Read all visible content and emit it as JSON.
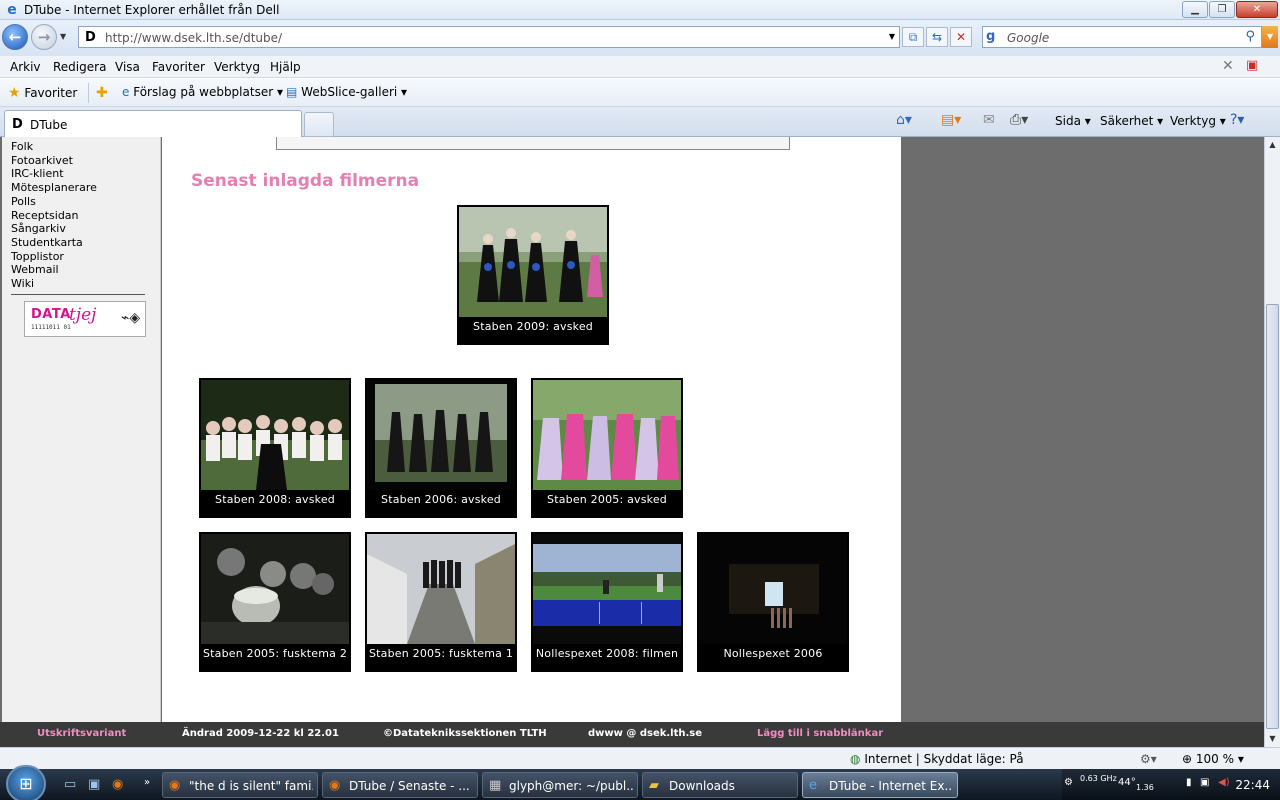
{
  "window": {
    "title": "DTube - Internet Explorer erhållet från Dell",
    "buttons": {
      "minimize": "▁",
      "maximize": "❐",
      "close": "✕"
    }
  },
  "address": {
    "url": "http://www.dsek.lth.se/dtube/",
    "search_placeholder": "Google"
  },
  "menu": [
    "Arkiv",
    "Redigera",
    "Visa",
    "Favoriter",
    "Verktyg",
    "Hjälp"
  ],
  "favorites_bar": {
    "favorites": "Favoriter",
    "suggested": "Förslag på webbplatser ▾",
    "webslice": "WebSlice-galleri ▾"
  },
  "tab": {
    "label": "DTube"
  },
  "commands": {
    "page": "Sida ▾",
    "safety": "Säkerhet ▾",
    "tools": "Verktyg ▾"
  },
  "sidebar": {
    "links": [
      "Folk",
      "Fotoarkivet",
      "IRC-klient",
      "Mötesplanerare",
      "Polls",
      "Receptsidan",
      "Sångarkiv",
      "Studentkarta",
      "Topplistor",
      "Webmail",
      "Wiki"
    ],
    "logo": {
      "part1": "DATA",
      "part2": "tjej",
      "bits": "11111011 01"
    }
  },
  "main": {
    "heading": "Senast inlagda filmerna",
    "featured": {
      "caption": "Staben 2009: avsked"
    },
    "row1": [
      {
        "caption": "Staben 2008: avsked"
      },
      {
        "caption": "Staben 2006: avsked"
      },
      {
        "caption": "Staben 2005: avsked"
      }
    ],
    "row2": [
      {
        "caption": "Staben 2005: fusktema 2"
      },
      {
        "caption": "Staben 2005: fusktema 1"
      },
      {
        "caption": "Nollespexet 2008: filmen"
      },
      {
        "caption": "Nollespexet 2006"
      }
    ]
  },
  "footer": {
    "print": "Utskriftsvariant",
    "changed": "Ändrad 2009-12-22 kl 22.01",
    "copyright": "©Datateknikssektionen TLTH",
    "contact": "dwww @ dsek.lth.se",
    "shortcut": "Lägg till i snabblänkar"
  },
  "status": {
    "zone": "Internet | Skyddat läge: På",
    "zoom": "100 %"
  },
  "taskbar": {
    "tasks": [
      "\"the d is silent\" fami...",
      "DTube / Senaste - ...",
      "glyph@mer: ~/publ...",
      "Downloads",
      "DTube - Internet Ex..."
    ],
    "clock": "22:44",
    "temp": "44°",
    "cpu": "0.63 GHz",
    "cpu2": "1.36"
  },
  "colors": {
    "heading": "#e47fb2",
    "footer_link": "#f08ec0"
  }
}
